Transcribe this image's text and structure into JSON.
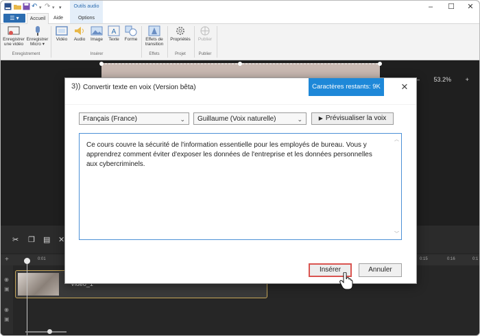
{
  "quick_access": {
    "undo_glyph": "↶",
    "redo_glyph": "↷",
    "more_glyph": "▾"
  },
  "context_tab": {
    "label": "Outils audio"
  },
  "window_controls": {
    "minimize": "–",
    "maximize": "☐",
    "close": "✕"
  },
  "ribbon_tabs": {
    "file_label": "☰ ▾",
    "accueil": "Accueil",
    "aide": "Aide",
    "options": "Options"
  },
  "ribbon": {
    "rec_video": "Enregistrer une vidéo",
    "rec_micro": "Enregistrer Micro ▾",
    "group_enregistrement": "Enregistrement",
    "video": "Vidéo",
    "audio": "Audio",
    "image": "Image",
    "texte": "Texte",
    "forme": "Forme",
    "group_inserer": "Insérer",
    "effets": "Effets de transition",
    "group_effets": "Effets",
    "proprietes": "Propriétés",
    "group_projet": "Projet",
    "publier": "Publier",
    "group_publier": "Publier"
  },
  "editor": {
    "zoom_minus": "–",
    "zoom_value": "53.2%",
    "zoom_plus": "+",
    "ruler_ticks": [
      "0:01",
      "0:15",
      "0:16",
      "0:1"
    ],
    "clip_name": "Vidéo_1",
    "add_track": "+"
  },
  "dialog": {
    "title": "Convertir texte en voix (Version bêta)",
    "chars_remaining": "Caractères restants: 9K",
    "close_glyph": "✕",
    "language": "Français (France)",
    "voice": "Guillaume (Voix naturelle)",
    "preview_label": "Prévisualiser la voix",
    "text": "Ce cours couvre la sécurité de l'information essentielle pour les employés de bureau. Vous y apprendrez comment éviter d'exposer les données de l'entreprise et les données personnelles aux cybercriminels.",
    "insert_label": "Insérer",
    "cancel_label": "Annuler"
  },
  "colors": {
    "accent": "#1e88d8",
    "highlight": "#d9534f",
    "clip_border": "#c8a85a"
  }
}
